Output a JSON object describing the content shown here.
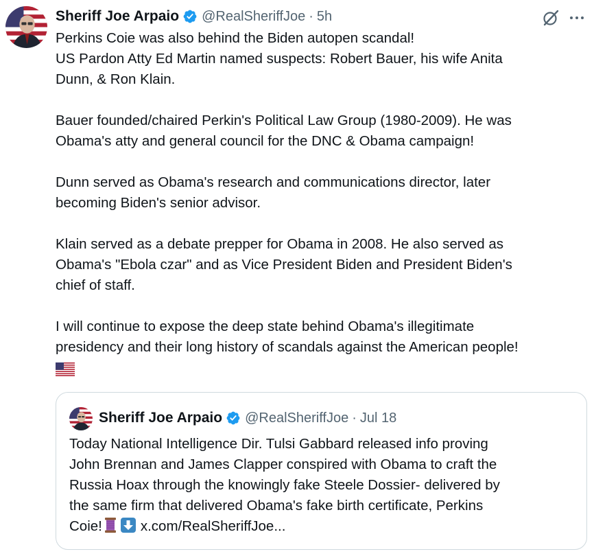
{
  "tweet": {
    "author_name": "Sheriff Joe Arpaio",
    "handle": "@RealSheriffJoe",
    "separator": "·",
    "time": "5h",
    "avatar_icon": "profile-avatar-flag",
    "verified_icon": "verified-badge-icon",
    "grok_icon": "grok-icon",
    "more_icon": "more-icon",
    "paragraphs": [
      [
        "Perkins Coie was also behind the Biden autopen scandal!",
        "US Pardon Atty Ed Martin named suspects: Robert Bauer, his wife Anita",
        "Dunn, & Ron Klain."
      ],
      [
        "Bauer founded/chaired Perkin's Political Law Group (1980-2009). He was",
        "Obama's atty and general council for the DNC & Obama campaign!"
      ],
      [
        "Dunn served as Obama's research and communications director, later",
        "becoming Biden's senior advisor."
      ],
      [
        "Klain served as a debate prepper for Obama in 2008. He also served as",
        "Obama's \"Ebola czar\" and as Vice President Biden and President Biden's",
        "chief of staff."
      ],
      [
        "I will continue to expose the deep state behind Obama's illegitimate",
        "presidency and their long history of scandals against the American people!"
      ]
    ],
    "flag_emoji": "us-flag-icon"
  },
  "quote": {
    "author_name": "Sheriff Joe Arpaio",
    "handle": "@RealSheriffJoe",
    "separator": "·",
    "time": "Jul 18",
    "lines": [
      "Today National Intelligence Dir. Tulsi Gabbard released info proving",
      "John Brennan and James Clapper conspired with Obama to craft the",
      "Russia Hoax through the knowingly fake Steele Dossier- delivered by",
      "the same firm that delivered Obama's fake birth certificate, Perkins"
    ],
    "last_line_prefix": "Coie!",
    "link_text": "x.com/RealSheriffJoe...",
    "thread_emoji": "thread-spool-icon",
    "down_emoji": "down-arrow-icon"
  },
  "colors": {
    "text": "#0f1419",
    "secondary": "#536471",
    "verified": "#1d9bf0",
    "border": "#cfd9de"
  }
}
